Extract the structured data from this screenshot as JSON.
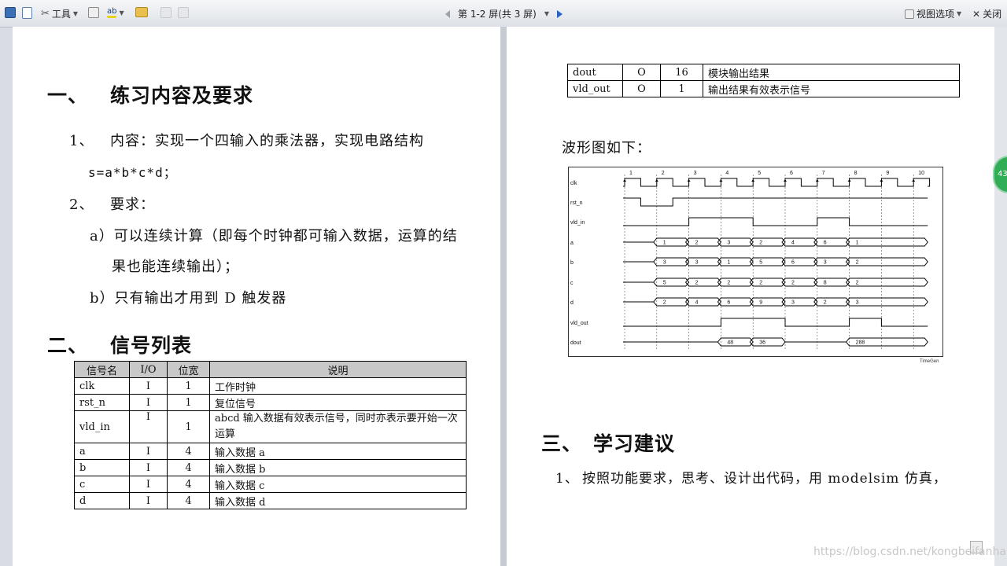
{
  "toolbar": {
    "tools_label": "工具",
    "page_status": "第 1-2 屏(共 3 屏)",
    "view_options_label": "视图选项",
    "close_label": "关闭"
  },
  "left_page": {
    "section1": {
      "num": "一、",
      "title": "练习内容及要求"
    },
    "item1": {
      "num": "1、",
      "text": "内容：实现一个四输入的乘法器，实现电路结构"
    },
    "item1_formula": "s=a*b*c*d；",
    "item2": {
      "num": "2、",
      "text": "要求："
    },
    "req_a_line1": "a）可以连续计算（即每个时钟都可输入数据，运算的结",
    "req_a_line2": "果也能连续输出）；",
    "req_b": "b）只有输出才用到 D 触发器",
    "section2": {
      "num": "二、",
      "title": "信号列表"
    },
    "table": {
      "headers": [
        "信号名",
        "I/O",
        "位宽",
        "说明"
      ],
      "rows": [
        [
          "clk",
          "I",
          "1",
          "工作时钟"
        ],
        [
          "rst_n",
          "I",
          "1",
          "复位信号"
        ],
        [
          "vld_in",
          "I",
          "1",
          "abcd 输入数据有效表示信号，同时亦表示要开始一次运算"
        ],
        [
          "a",
          "I",
          "4",
          "输入数据 a"
        ],
        [
          "b",
          "I",
          "4",
          "输入数据 b"
        ],
        [
          "c",
          "I",
          "4",
          "输入数据 c"
        ],
        [
          "d",
          "I",
          "4",
          "输入数据 d"
        ]
      ]
    }
  },
  "right_page": {
    "table": {
      "rows": [
        [
          "dout",
          "O",
          "16",
          "模块输出结果"
        ],
        [
          "vld_out",
          "O",
          "1",
          "输出结果有效表示信号"
        ]
      ]
    },
    "waveform_caption": "波形图如下：",
    "section3": {
      "num": "三、",
      "title": "学习建议"
    },
    "item1": {
      "num": "1、",
      "text": "按照功能要求，思考、设计出代码，用 modelsim 仿真，"
    }
  },
  "waveform": {
    "clock_numbers": [
      "1",
      "2",
      "3",
      "4",
      "5",
      "6",
      "7",
      "8",
      "9",
      "10"
    ],
    "signals": [
      "clk",
      "rst_n",
      "vld_in",
      "a",
      "b",
      "c",
      "d",
      "vld_out",
      "dout"
    ],
    "a_values": [
      "1",
      "2",
      "3",
      "2",
      "4",
      "6",
      "1"
    ],
    "b_values": [
      "3",
      "3",
      "1",
      "5",
      "6",
      "3",
      "2"
    ],
    "c_values": [
      "5",
      "2",
      "2",
      "2",
      "2",
      "8",
      "2"
    ],
    "d_values": [
      "2",
      "4",
      "6",
      "9",
      "3",
      "2",
      "3"
    ],
    "dout_values": [
      "48",
      "36",
      "288"
    ],
    "tool_label": "TimeGen"
  },
  "side_badge": "43",
  "watermark": "https://blog.csdn.net/kongbeifanhai"
}
